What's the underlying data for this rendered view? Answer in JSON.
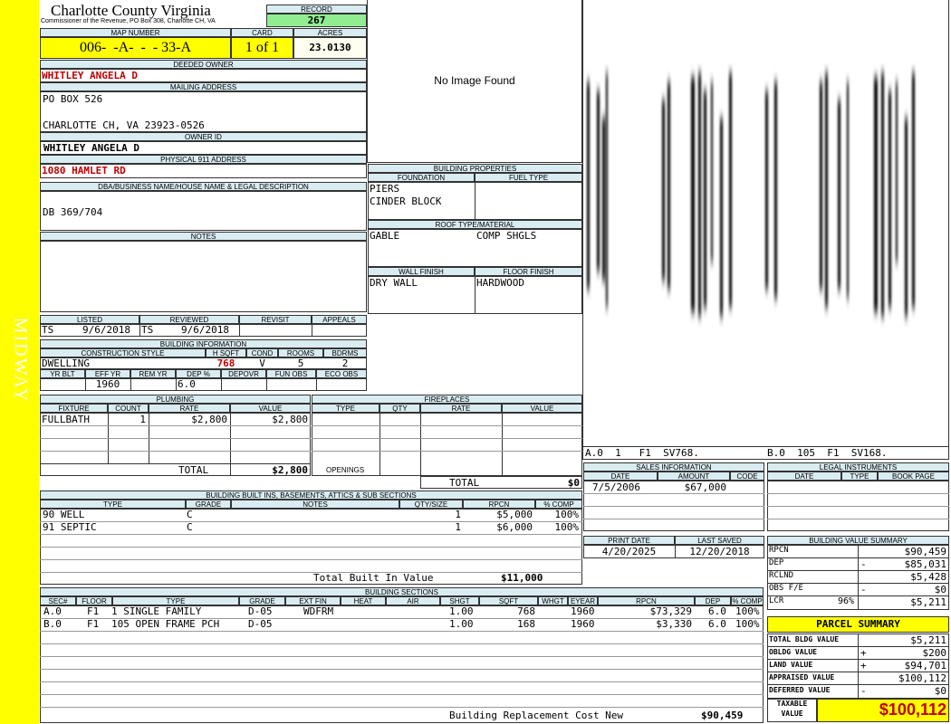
{
  "side_label": "MIDWAY",
  "header": {
    "county": "Charlotte County Virginia",
    "subtitle": "Commissioner of the Revenue, PO Box 308, Charlotte CH, VA",
    "record_label": "RECORD",
    "record": "267",
    "map_label": "MAP NUMBER",
    "map_number": "006-  -A-  -  - 33-A",
    "card_label": "CARD",
    "card": "1 of 1",
    "acres_label": "ACRES",
    "acres": "23.0130"
  },
  "owner": {
    "deeded_label": "DEEDED OWNER",
    "deeded": "WHITLEY ANGELA D",
    "mailing_label": "MAILING ADDRESS",
    "mail1": "PO BOX 526",
    "mail2": "CHARLOTTE CH, VA 23923-0526",
    "id_label": "OWNER ID",
    "owner_id": "WHITLEY ANGELA D",
    "phys_label": "PHYSICAL 911 ADDRESS",
    "phys": "1080 HAMLET RD",
    "legal_label": "DBA/BUSINESS NAME/HOUSE NAME & LEGAL DESCRIPTION",
    "legal": "DB 369/704",
    "notes_label": "NOTES"
  },
  "image_text": "No Image Found",
  "review": {
    "listed_label": "LISTED",
    "reviewed_label": "REVIEWED",
    "revisit_label": "REVISIT",
    "appeals_label": "APPEALS",
    "listed_by": "TS",
    "listed_date": "9/6/2018",
    "reviewed_by": "TS",
    "reviewed_date": "9/6/2018"
  },
  "building_info": {
    "title": "BUILDING INFORMATION",
    "h_style": "CONSTRUCTION STYLE",
    "h_sqft": "H SQFT",
    "h_cond": "COND",
    "h_rooms": "ROOMS",
    "h_bdrms": "BDRMS",
    "style": "DWELLING",
    "sqft": "768",
    "cond": "V",
    "rooms": "5",
    "bdrms": "2",
    "h_yrblt": "YR BLT",
    "h_effyr": "EFF YR",
    "h_remyr": "REM YR",
    "h_dep": "DEP %",
    "h_depovr": "DEPOVR",
    "h_funobs": "FUN OBS",
    "h_ecoobs": "ECO OBS",
    "effyr": "1960",
    "dep": "6.0"
  },
  "building_props": {
    "title": "BUILDING PROPERTIES",
    "h_foundation": "FOUNDATION",
    "h_fuel": "FUEL TYPE",
    "foundation1": "PIERS",
    "foundation2": "CINDER BLOCK",
    "h_roof": "ROOF TYPE/MATERIAL",
    "roof_type": "GABLE",
    "roof_material": "COMP SHGLS",
    "h_wall": "WALL FINISH",
    "h_floor": "FLOOR FINISH",
    "wall": "DRY WALL",
    "floor": "HARDWOOD"
  },
  "sketch_labels": {
    "left": "A.0  1   F1  SV768.",
    "right": "B.0  105  F1  SV168."
  },
  "plumbing": {
    "title": "PLUMBING",
    "h_fixture": "FIXTURE",
    "h_count": "COUNT",
    "h_rate": "RATE",
    "h_value": "VALUE",
    "fixture": "FULLBATH",
    "count": "1",
    "rate": "$2,800",
    "value": "$2,800",
    "total_label": "TOTAL",
    "total": "$2,800"
  },
  "fireplaces": {
    "title": "FIREPLACES",
    "h_type": "TYPE",
    "h_qty": "QTY",
    "h_rate": "RATE",
    "h_value": "VALUE",
    "openings": "OPENINGS",
    "total_label": "TOTAL",
    "total": "$0"
  },
  "sales": {
    "title": "SALES INFORMATION",
    "h_date": "DATE",
    "h_amount": "AMOUNT",
    "h_code": "CODE",
    "date": "7/5/2006",
    "amount": "$67,000"
  },
  "legal_instruments": {
    "title": "LEGAL INSTRUMENTS",
    "h_date": "DATE",
    "h_type": "TYPE",
    "h_book": "BOOK PAGE"
  },
  "print": {
    "print_label": "PRINT DATE",
    "saved_label": "LAST SAVED",
    "print_date": "4/20/2025",
    "saved_date": "12/20/2018"
  },
  "builtins": {
    "title": "BUILDING BUILT INS, BASEMENTS, ATTICS & SUB SECTIONS",
    "h_type": "TYPE",
    "h_grade": "GRADE",
    "h_notes": "NOTES",
    "h_qty": "QTY/SIZE",
    "h_rpcn": "RPCN",
    "h_comp": "% COMP",
    "rows": [
      {
        "type": "90 WELL",
        "grade": "C",
        "qty": "1",
        "rpcn": "$5,000",
        "comp": "100%"
      },
      {
        "type": "91 SEPTIC",
        "grade": "C",
        "qty": "1",
        "rpcn": "$6,000",
        "comp": "100%"
      }
    ],
    "total_label": "Total Built In Value",
    "total": "$11,000"
  },
  "value_summary": {
    "title": "BUILDING VALUE SUMMARY",
    "rpcn_label": "RPCN",
    "rpcn": "$90,459",
    "dep_label": "DEP",
    "dep_sign": "-",
    "dep": "$85,031",
    "rclnd_label": "RCLND",
    "rclnd": "$5,428",
    "obs_label": "OBS F/E",
    "obs_sign": "-",
    "obs": "$0",
    "lcr_label": "LCR",
    "lcr_pct": "96%",
    "lcr": "$5,211"
  },
  "parcel_summary": {
    "title": "PARCEL SUMMARY",
    "bldg_label": "TOTAL BLDG VALUE",
    "bldg": "$5,211",
    "obldg_label": "OBLDG VALUE",
    "obldg_sign": "+",
    "obldg": "$200",
    "land_label": "LAND VALUE",
    "land_sign": "+",
    "land": "$94,701",
    "appraised_label": "APPRAISED VALUE",
    "appraised": "$100,112",
    "deferred_label": "DEFERRED VALUE",
    "deferred_sign": "-",
    "deferred": "$0",
    "taxable_label1": "TAXABLE",
    "taxable_label2": "VALUE",
    "taxable": "$100,112"
  },
  "sections": {
    "title": "BUILDING SECTIONS",
    "h": {
      "sec": "SEC#",
      "floor": "FLOOR",
      "type": "TYPE",
      "grade": "GRADE",
      "extfin": "EXT FIN",
      "heat": "HEAT",
      "air": "AIR",
      "shgt": "SHGT",
      "sqft": "SQFT",
      "whgt": "WHGT",
      "eyear": "EYEAR",
      "rpcn": "RPCN",
      "dep": "DEP",
      "comp": "% COMP"
    },
    "rows": [
      {
        "sec": "A.0",
        "floor": "F1",
        "type": "1 SINGLE FAMILY",
        "grade": "D-05",
        "extfin": "WDFRM",
        "shgt": "1.00",
        "sqft": "768",
        "eyear": "1960",
        "rpcn": "$73,329",
        "dep": "6.0",
        "comp": "100%"
      },
      {
        "sec": "B.0",
        "floor": "F1",
        "type": "105 OPEN FRAME PCH",
        "grade": "D-05",
        "extfin": "",
        "shgt": "1.00",
        "sqft": "168",
        "eyear": "1960",
        "rpcn": "$3,330",
        "dep": "6.0",
        "comp": "100%"
      }
    ],
    "replacement_label": "Building Replacement Cost New",
    "replacement": "$90,459"
  },
  "colors": {
    "side_bar": "#ffff00",
    "header_bg": "#d9ecf2",
    "accent_red": "#c00000",
    "record_bg": "#90ee90"
  }
}
